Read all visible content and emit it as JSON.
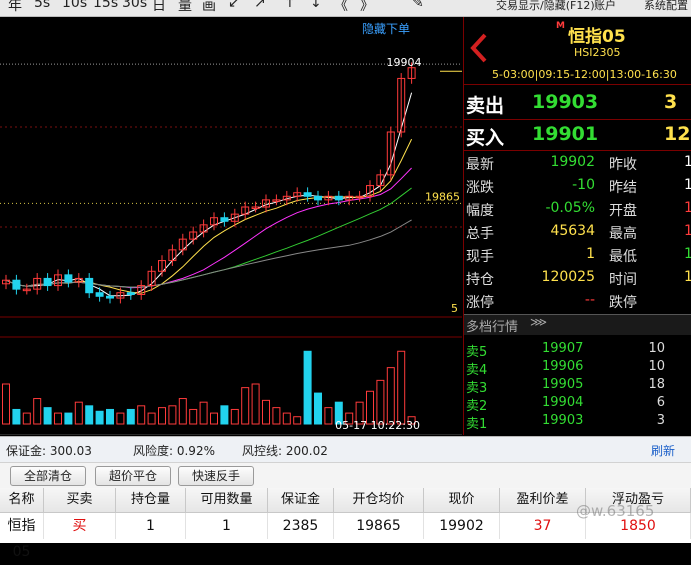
{
  "toolbar": {
    "items": [
      "年",
      "5s",
      "10s",
      "15s",
      "30s",
      "日",
      "量",
      "画",
      "↙",
      "↗",
      "↑",
      "↓",
      "《",
      "》",
      "✎"
    ],
    "right_links": [
      "交易显示/隐藏(F12)",
      "账户",
      "系统配置"
    ]
  },
  "chart": {
    "hide_ticket_label": "隐藏下单",
    "high_label": "19904",
    "price_tag": "19865",
    "level_tag": "5",
    "timestamp": "05-17 10:22:30"
  },
  "chart_data": {
    "type": "candlestick",
    "series": [
      {
        "name": "",
        "values": [
          19843.5,
          19841,
          19841,
          19844,
          19842,
          19845,
          19843,
          19844,
          19840,
          19839,
          19838.5,
          19840,
          19839.5,
          19842,
          19846,
          19849,
          19852,
          19855,
          19857,
          19859,
          19861,
          19860,
          19862,
          19864,
          19864,
          19866,
          19866,
          19867,
          19868,
          19867,
          19866,
          19867,
          19866,
          19867,
          19867,
          19870,
          19873,
          19885,
          19900,
          19903
        ]
      }
    ],
    "volume": [
      22,
      8,
      6,
      14,
      9,
      6,
      6,
      12,
      10,
      7,
      8,
      6,
      8,
      10,
      6,
      9,
      10,
      14,
      8,
      12,
      6,
      10,
      8,
      20,
      22,
      13,
      9,
      6,
      4,
      40,
      17,
      9,
      12,
      6,
      12,
      18,
      24,
      31,
      40,
      4
    ],
    "candle_colors": {
      "up": "#ff4040",
      "down": "#22d3ee"
    }
  },
  "instrument": {
    "name": "恒指05",
    "code": "HSI2305",
    "session": "5-03:00|09:15-12:00|13:00-16:30"
  },
  "quote": {
    "sell_label": "卖出",
    "sell_price": "19903",
    "sell_qty": "3",
    "buy_label": "买入",
    "buy_price": "19901",
    "buy_qty": "12",
    "rows": [
      {
        "l1": "最新",
        "v1": "19902",
        "l2": "昨收",
        "v2": "19"
      },
      {
        "l1": "涨跌",
        "v1": "-10",
        "l2": "昨结",
        "v2": "19"
      },
      {
        "l1": "幅度",
        "v1": "-0.05%",
        "l2": "开盘",
        "v2": "19"
      },
      {
        "l1": "总手",
        "v1": "45634",
        "l2": "最高",
        "v2": "19"
      },
      {
        "l1": "现手",
        "v1": "1",
        "l2": "最低",
        "v2": "19"
      },
      {
        "l1": "持仓",
        "v1": "120025",
        "l2": "时间",
        "v2": "10:2"
      },
      {
        "l1": "涨停",
        "v1": "--",
        "l2": "跌停",
        "v2": ""
      }
    ]
  },
  "depth": {
    "title": "多档行情",
    "rows": [
      {
        "label": "卖5",
        "price": "19907",
        "qty": "10"
      },
      {
        "label": "卖4",
        "price": "19906",
        "qty": "10"
      },
      {
        "label": "卖3",
        "price": "19905",
        "qty": "18"
      },
      {
        "label": "卖2",
        "price": "19904",
        "qty": "6"
      },
      {
        "label": "卖1",
        "price": "19903",
        "qty": "3"
      }
    ]
  },
  "status": {
    "margin": "保证金: 300.03",
    "risk": "风险度: 0.92%",
    "line": "风控线: 200.02",
    "refresh": "刷新"
  },
  "buttons": {
    "close_all": "全部清仓",
    "quick_close": "超价平仓",
    "reverse": "快速反手"
  },
  "positions": {
    "headers": [
      "名称",
      "买卖",
      "持仓量",
      "可用数量",
      "保证金",
      "开仓均价",
      "现价",
      "盈利价差",
      "浮动盈亏"
    ],
    "row": [
      "恒指05",
      "买",
      "1",
      "1",
      "2385",
      "19865",
      "19902",
      "37",
      "1850"
    ],
    "watermark": "@w.63165"
  },
  "colors": {
    "up": "#ff3b3b",
    "down": "#22d3ee",
    "green": "#33dd33",
    "yellow": "#ffe14d",
    "accent_red": "#cc1111"
  }
}
